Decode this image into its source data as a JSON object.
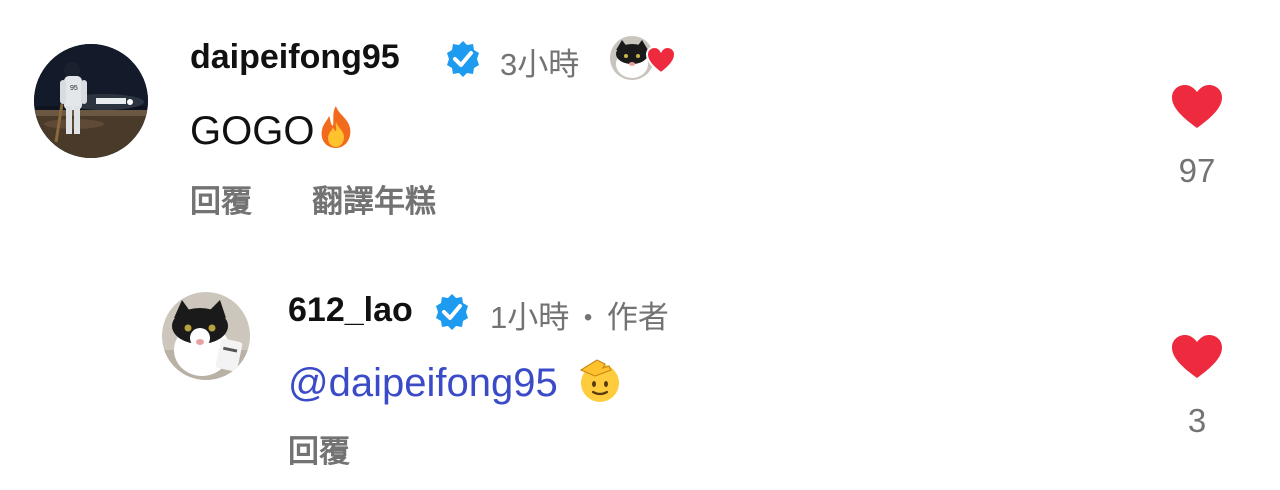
{
  "comments": [
    {
      "username": "daipeifong95",
      "verified": true,
      "time": "3小時",
      "text": "GOGO",
      "emoji": "fire",
      "actions": {
        "reply": "回覆",
        "translate": "翻譯年糕"
      },
      "likes": "97",
      "author_liked": true
    },
    {
      "username": "612_lao",
      "verified": true,
      "time": "1小時",
      "separator": "•",
      "author_tag": "作者",
      "mention_symbol": "@",
      "mention": "daipeifong95",
      "emoji": "saluting-face",
      "actions": {
        "reply": "回覆"
      },
      "likes": "3"
    }
  ],
  "colors": {
    "heart": "#ee2a3f",
    "verified": "#1d9bf0",
    "mention": "#3b4bc8",
    "muted": "#737373"
  }
}
